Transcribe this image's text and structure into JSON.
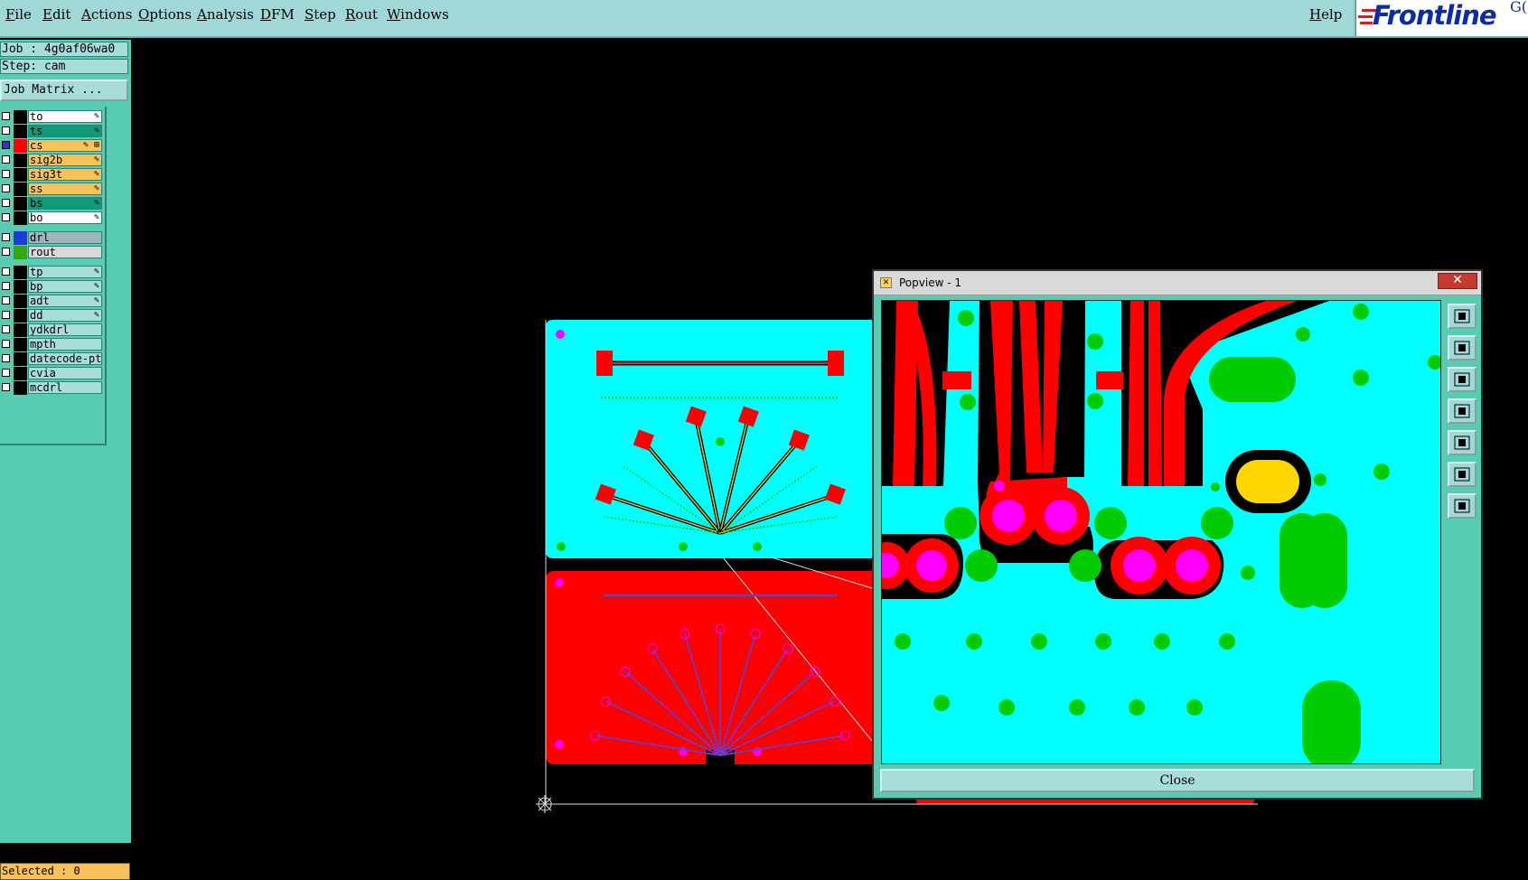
{
  "menubar": {
    "items": [
      "File",
      "Edit",
      "Actions",
      "Options",
      "Analysis",
      "DFM",
      "Step",
      "Rout",
      "Windows"
    ],
    "help": "Help",
    "logo_text": "Frontline",
    "logo_suffix": "G("
  },
  "info": {
    "job": "Job : 4g0af06wa0",
    "step": "Step: cam",
    "job_matrix": "Job Matrix ..."
  },
  "layers": [
    {
      "name": "to",
      "color": "#000000",
      "bg": "#ffffff",
      "flag": "✎"
    },
    {
      "name": "ts",
      "color": "#000000",
      "bg": "#0f9a78",
      "flag": "✎"
    },
    {
      "name": "cs",
      "color": "#ff0000",
      "bg": "#f8c25a",
      "flag": "✎ ⊞",
      "active": true
    },
    {
      "name": "sig2b",
      "color": "#000000",
      "bg": "#f8c25a",
      "flag": "✎"
    },
    {
      "name": "sig3t",
      "color": "#000000",
      "bg": "#f8c25a",
      "flag": "✎"
    },
    {
      "name": "ss",
      "color": "#000000",
      "bg": "#f8c25a",
      "flag": "✎"
    },
    {
      "name": "bs",
      "color": "#000000",
      "bg": "#0f9a78",
      "flag": "✎"
    },
    {
      "name": "bo",
      "color": "#000000",
      "bg": "#ffffff",
      "flag": "✎"
    },
    {
      "name": "drl",
      "color": "#1d3bd8",
      "bg": "#a0b4bc",
      "flag": ""
    },
    {
      "name": "rout",
      "color": "#34a812",
      "bg": "#d9d9d9",
      "flag": ""
    },
    {
      "name": "tp",
      "color": "#000000",
      "bg": "#a7dedb",
      "flag": "✎"
    },
    {
      "name": "bp",
      "color": "#000000",
      "bg": "#a7dedb",
      "flag": "✎"
    },
    {
      "name": "adt",
      "color": "#000000",
      "bg": "#a7dedb",
      "flag": "✎"
    },
    {
      "name": "dd",
      "color": "#000000",
      "bg": "#a7dedb",
      "flag": "✎"
    },
    {
      "name": "ydkdrl",
      "color": "#000000",
      "bg": "#a7dedb",
      "flag": ""
    },
    {
      "name": "mpth",
      "color": "#000000",
      "bg": "#a7dedb",
      "flag": ""
    },
    {
      "name": "datecode-pte",
      "color": "#000000",
      "bg": "#a7dedb",
      "flag": ""
    },
    {
      "name": "cvia",
      "color": "#000000",
      "bg": "#a7dedb",
      "flag": ""
    },
    {
      "name": "mcdrl",
      "color": "#000000",
      "bg": "#a7dedb",
      "flag": ""
    }
  ],
  "status": {
    "selected": "Selected : 0"
  },
  "popview": {
    "title": "Popview - 1",
    "close_label": "Close",
    "close_x": "✕",
    "tools": [
      "zoom-window-icon",
      "pan-up-icon",
      "pan-down-icon",
      "pan-left-icon",
      "pan-right-icon",
      "zoom-fit-icon",
      "zoom-home-icon"
    ]
  },
  "colors": {
    "menubar": "#9fd8d6",
    "panel": "#56cdb0",
    "copper": "#ff0000",
    "board_top": "#00ffff",
    "pad_green": "#00cc00",
    "drill_magenta": "#ff00ff"
  }
}
